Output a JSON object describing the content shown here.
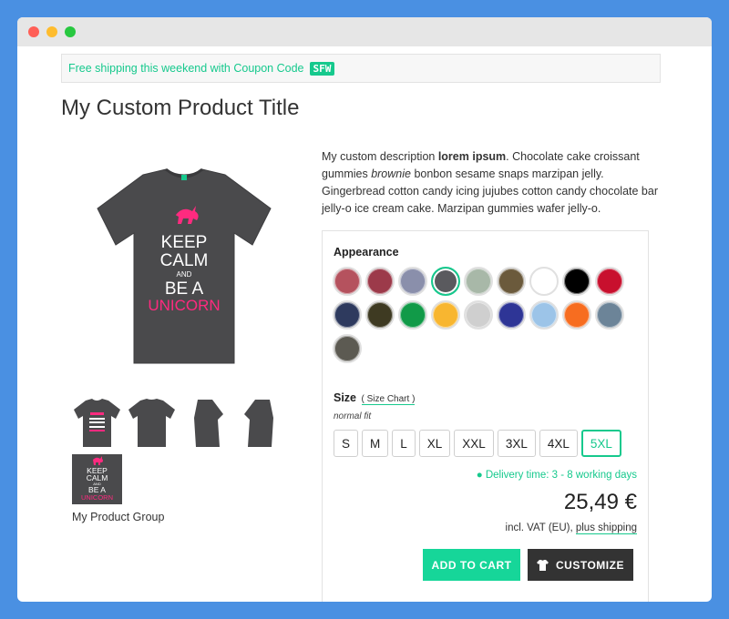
{
  "promo": {
    "text": "Free shipping this weekend with Coupon Code",
    "code": "SFW"
  },
  "product": {
    "title": "My Custom Product Title",
    "image_text": [
      "KEEP",
      "CALM",
      "AND",
      "BE A",
      "UNICORN"
    ],
    "thumb_text": [
      "KEEP",
      "CALM",
      "AND",
      "BE A",
      "UNICORN"
    ],
    "group_label": "My Product Group"
  },
  "description": {
    "intro": "My custom description ",
    "bold": "lorem ipsum",
    "part2": ". Chocolate cake croissant gummies ",
    "italic": "brownie",
    "part3": " bonbon sesame snaps marzipan jelly. Gingerbread cotton candy icing jujubes cotton candy chocolate bar jelly-o ice cream cake. Marzipan gummies wafer jelly-o."
  },
  "appearance": {
    "label": "Appearance",
    "swatches": [
      {
        "color": "#b5525e"
      },
      {
        "color": "#9c3a4a"
      },
      {
        "color": "#8a8fab"
      },
      {
        "color": "#5a5a5e",
        "selected": true
      },
      {
        "color": "#a8b8a8"
      },
      {
        "color": "#6b5a3c"
      },
      {
        "color": "#ffffff"
      },
      {
        "color": "#000000"
      },
      {
        "color": "#c8102e"
      },
      {
        "color": "#2e3a5e"
      },
      {
        "color": "#3e3a22"
      },
      {
        "color": "#119a48"
      },
      {
        "color": "#f8b630"
      },
      {
        "color": "#cfcfcf"
      },
      {
        "color": "#2e3596"
      },
      {
        "color": "#9cc4e8"
      },
      {
        "color": "#f76d20"
      },
      {
        "color": "#6c8498"
      },
      {
        "color": "#5c5a52"
      }
    ]
  },
  "size": {
    "label": "Size",
    "chart_link": "( Size Chart )",
    "fit": "normal fit",
    "options": [
      "S",
      "M",
      "L",
      "XL",
      "XXL",
      "3XL",
      "4XL",
      "5XL"
    ],
    "selected": "5XL"
  },
  "delivery": "● Delivery time: 3 - 8 working days",
  "price": "25,49 €",
  "vat": {
    "prefix": "incl. VAT (EU), ",
    "link": "plus shipping"
  },
  "buttons": {
    "cart": "ADD TO CART",
    "customize": "CUSTOMIZE"
  },
  "colors": {
    "accent": "#16c98d",
    "shirt": "#4a4a4c",
    "print": "#ff2a7f",
    "dark_button": "#333333"
  }
}
